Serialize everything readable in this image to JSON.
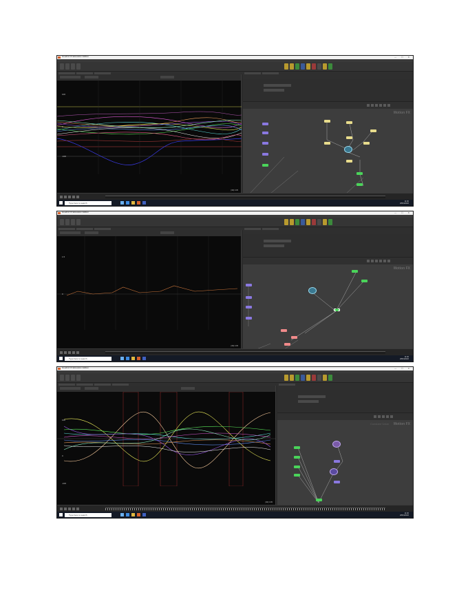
{
  "window": {
    "title": "Houdini FX Education Edition",
    "menu": [
      "File",
      "Edit",
      "Render",
      "Assets",
      "Windows",
      "Help"
    ],
    "controls": "—  ☐  ✕"
  },
  "screenshots": [
    {
      "graph": {
        "y_top": "100",
        "y_mid": "0",
        "y_bottom": "-100",
        "corner": "[3D] 0.05"
      },
      "network": {
        "context": "Motion FX"
      }
    },
    {
      "graph": {
        "y_top": "1.5",
        "y_mid": "0",
        "corner": "[3D] 0.05"
      },
      "network": {
        "context": "Motion FX"
      }
    },
    {
      "graph": {
        "y_top": "100",
        "y_mid": "0",
        "y_bottom": "-100",
        "corner": "[3D] 0.05"
      },
      "network": {
        "context": "Motion FX",
        "context2": "Constant Value"
      }
    }
  ],
  "taskbar": {
    "search_placeholder": "Type here to search",
    "time": "11:00",
    "date": "28/04/2020"
  }
}
